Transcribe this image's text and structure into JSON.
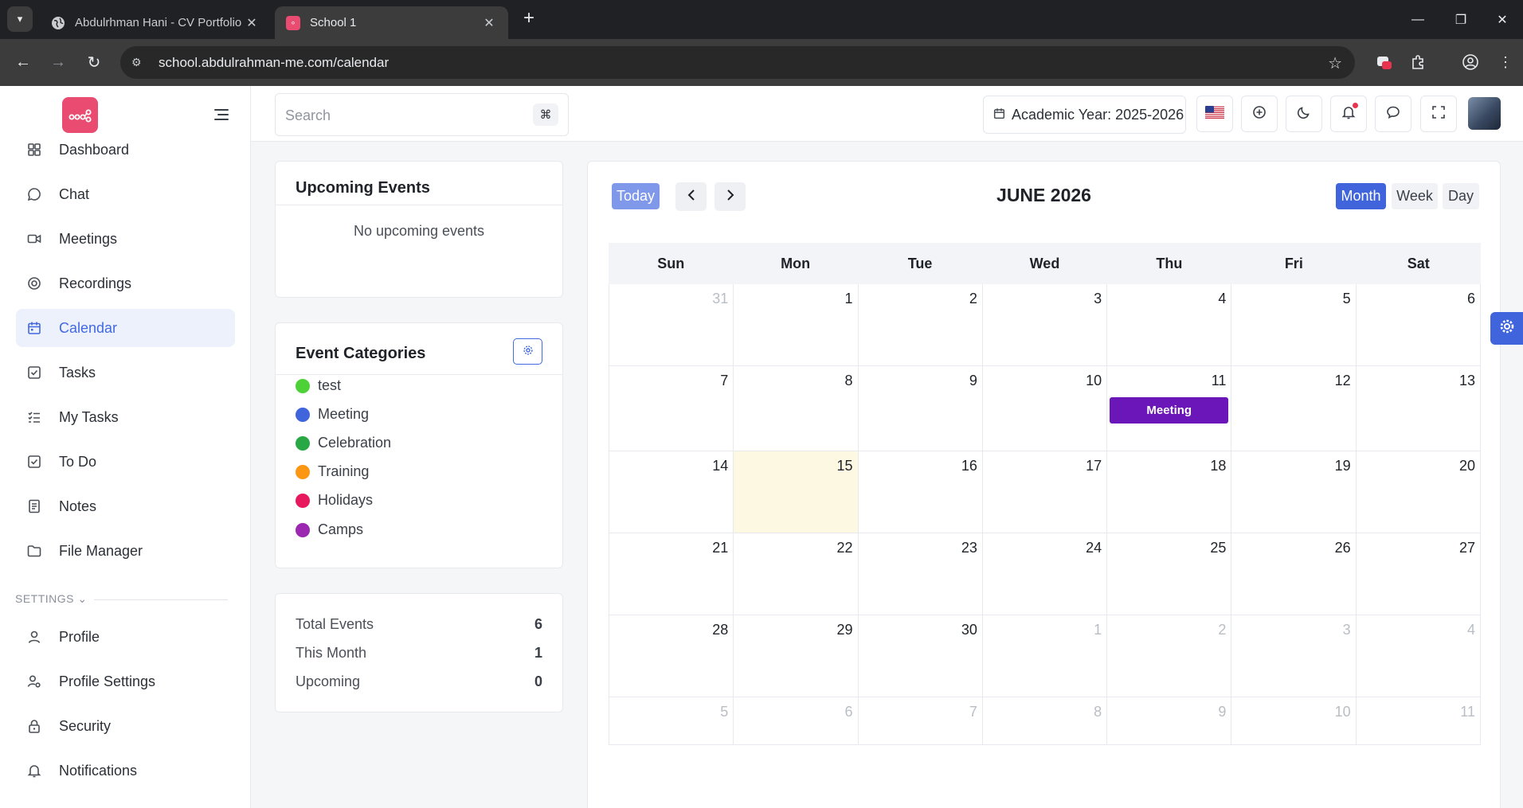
{
  "browser": {
    "tabs": [
      {
        "title": "Abdulrhman Hani - CV Portfolio",
        "active": false,
        "icon": "globe-icon"
      },
      {
        "title": "School 1",
        "active": true,
        "icon": "school-app-icon"
      }
    ],
    "url": "school.abdulrahman-me.com/calendar"
  },
  "sidebar": {
    "items": [
      {
        "label": "Dashboard",
        "icon": "dashboard-icon",
        "active": false
      },
      {
        "label": "Chat",
        "icon": "chat-icon",
        "active": false
      },
      {
        "label": "Meetings",
        "icon": "video-icon",
        "active": false
      },
      {
        "label": "Recordings",
        "icon": "recording-icon",
        "active": false
      },
      {
        "label": "Calendar",
        "icon": "calendar-icon",
        "active": true
      },
      {
        "label": "Tasks",
        "icon": "task-check-icon",
        "active": false
      },
      {
        "label": "My Tasks",
        "icon": "list-check-icon",
        "active": false
      },
      {
        "label": "To Do",
        "icon": "todo-icon",
        "active": false
      },
      {
        "label": "Notes",
        "icon": "note-icon",
        "active": false
      },
      {
        "label": "File Manager",
        "icon": "folder-icon",
        "active": false
      }
    ],
    "settings_heading": "SETTINGS",
    "settings_items": [
      {
        "label": "Profile",
        "icon": "user-icon"
      },
      {
        "label": "Profile Settings",
        "icon": "user-gear-icon"
      },
      {
        "label": "Security",
        "icon": "lock-icon"
      },
      {
        "label": "Notifications",
        "icon": "bell-icon"
      }
    ]
  },
  "header": {
    "search_placeholder": "Search",
    "shortcut": "⌘",
    "academic_year": "Academic Year: 2025-2026"
  },
  "upcoming": {
    "title": "Upcoming Events",
    "empty": "No upcoming events"
  },
  "categories": {
    "title": "Event Categories",
    "items": [
      {
        "label": "test",
        "color": "#4cd137"
      },
      {
        "label": "Meeting",
        "color": "#3f64dc"
      },
      {
        "label": "Celebration",
        "color": "#28a745"
      },
      {
        "label": "Training",
        "color": "#fd9612"
      },
      {
        "label": "Holidays",
        "color": "#e8185f"
      },
      {
        "label": "Camps",
        "color": "#9c27b0"
      }
    ]
  },
  "stats": [
    {
      "label": "Total Events",
      "value": "6"
    },
    {
      "label": "This Month",
      "value": "1"
    },
    {
      "label": "Upcoming",
      "value": "0"
    }
  ],
  "calendar": {
    "today_label": "Today",
    "title": "JUNE 2026",
    "views": [
      {
        "label": "Month",
        "active": true
      },
      {
        "label": "Week",
        "active": false
      },
      {
        "label": "Day",
        "active": false
      }
    ],
    "weekdays": [
      "Sun",
      "Mon",
      "Tue",
      "Wed",
      "Thu",
      "Fri",
      "Sat"
    ],
    "weeks": [
      [
        {
          "d": "31",
          "other": true
        },
        {
          "d": "1"
        },
        {
          "d": "2"
        },
        {
          "d": "3"
        },
        {
          "d": "4"
        },
        {
          "d": "5"
        },
        {
          "d": "6"
        }
      ],
      [
        {
          "d": "7"
        },
        {
          "d": "8"
        },
        {
          "d": "9"
        },
        {
          "d": "10"
        },
        {
          "d": "11",
          "event": "Meeting"
        },
        {
          "d": "12"
        },
        {
          "d": "13"
        }
      ],
      [
        {
          "d": "14"
        },
        {
          "d": "15",
          "today": true
        },
        {
          "d": "16"
        },
        {
          "d": "17"
        },
        {
          "d": "18"
        },
        {
          "d": "19"
        },
        {
          "d": "20"
        }
      ],
      [
        {
          "d": "21"
        },
        {
          "d": "22"
        },
        {
          "d": "23"
        },
        {
          "d": "24"
        },
        {
          "d": "25"
        },
        {
          "d": "26"
        },
        {
          "d": "27"
        }
      ],
      [
        {
          "d": "28"
        },
        {
          "d": "29"
        },
        {
          "d": "30"
        },
        {
          "d": "1",
          "other": true
        },
        {
          "d": "2",
          "other": true
        },
        {
          "d": "3",
          "other": true
        },
        {
          "d": "4",
          "other": true
        }
      ],
      [
        {
          "d": "5",
          "other": true
        },
        {
          "d": "6",
          "other": true
        },
        {
          "d": "7",
          "other": true
        },
        {
          "d": "8",
          "other": true
        },
        {
          "d": "9",
          "other": true
        },
        {
          "d": "10",
          "other": true
        },
        {
          "d": "11",
          "other": true
        }
      ]
    ]
  },
  "colors": {
    "accent": "#4169e1",
    "event": "#6a16b8",
    "today_bg": "#fdf8e1",
    "brand": "#ea4c71"
  }
}
